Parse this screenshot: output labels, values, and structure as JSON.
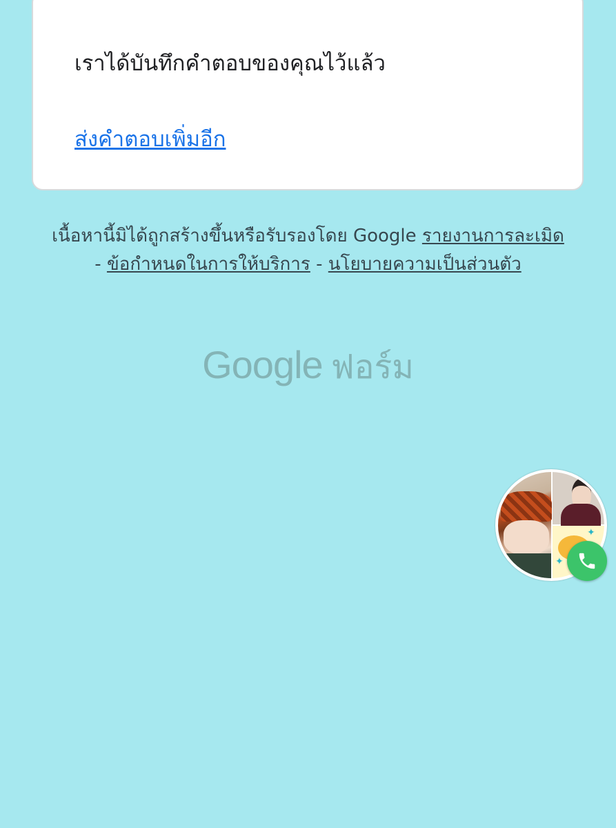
{
  "card": {
    "confirmation": "เราได้บันทึกคำตอบของคุณไว้แล้ว",
    "submit_another_link": "ส่งคำตอบเพิ่มอีก"
  },
  "footer": {
    "disclaimer": "เนื้อหานี้มิได้ถูกสร้างขึ้นหรือรับรองโดย Google",
    "report_abuse": "รายงานการละเมิด",
    "separator": "-",
    "terms": "ข้อกำหนดในการให้บริการ",
    "privacy": "นโยบายความเป็นส่วนตัว"
  },
  "brand": {
    "google": "Google",
    "product": "ฟอร์ม"
  },
  "floating_chat": {
    "icon": "phone-icon"
  },
  "colors": {
    "background": "#a6e8ef",
    "link": "#1a73e8",
    "call_badge": "#3cc46a"
  }
}
